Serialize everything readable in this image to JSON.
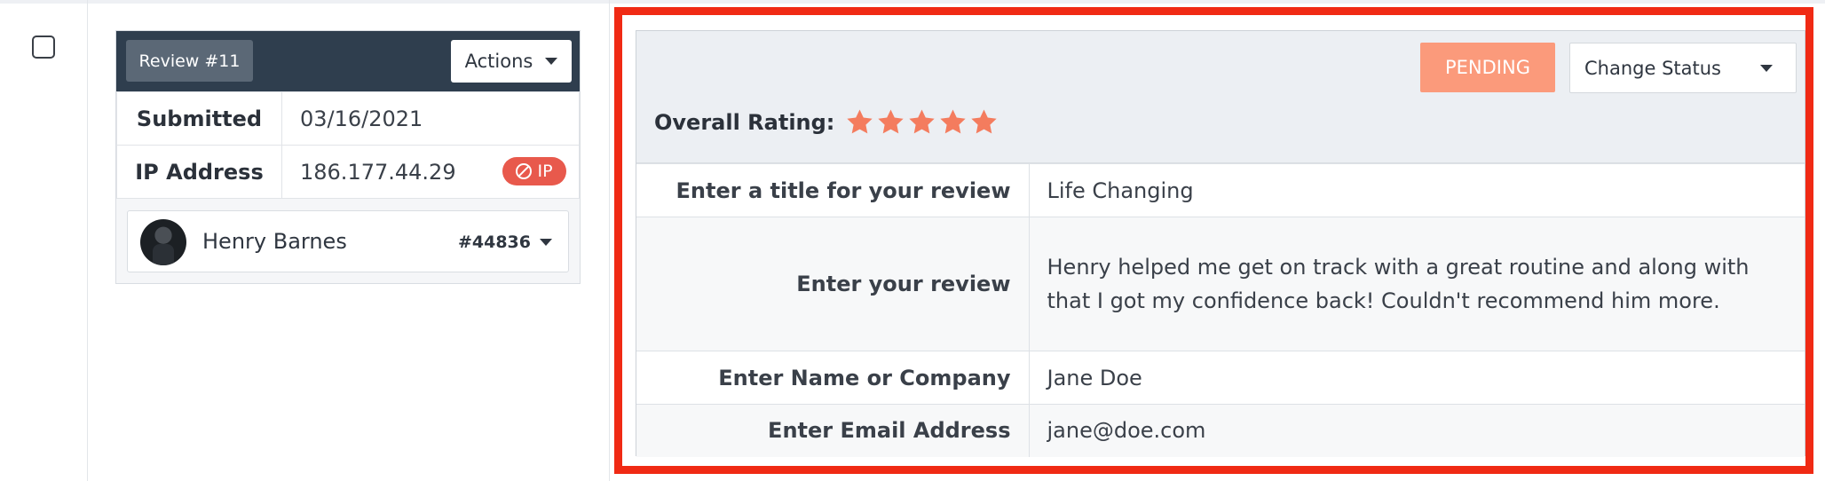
{
  "left_card": {
    "review_badge": "Review #11",
    "actions_label": "Actions",
    "submitted_label": "Submitted",
    "submitted_value": "03/16/2021",
    "ip_label": "IP Address",
    "ip_value": "186.177.44.29",
    "ip_ban_label": "IP",
    "user": {
      "name": "Henry Barnes",
      "id": "#44836"
    }
  },
  "review_panel": {
    "status_badge": "PENDING",
    "change_status_label": "Change Status",
    "overall_rating_label": "Overall Rating:",
    "rating": 5,
    "star_color": "#f47c5e",
    "fields": [
      {
        "label": "Enter a title for your review",
        "value": "Life Changing"
      },
      {
        "label": "Enter your review",
        "value_line1": "Henry helped me get on track with a great routine and along with",
        "value_line2": "that I got my confidence back! Couldn't recommend him more."
      },
      {
        "label": "Enter Name or Company",
        "value": "Jane Doe"
      },
      {
        "label": "Enter Email Address",
        "value": "jane@doe.com"
      }
    ]
  },
  "colors": {
    "highlight": "#f02a14",
    "header_dark": "#2f3e4e",
    "pending": "#fb9a7b",
    "ip_ban": "#e8594c"
  },
  "icons": [
    "checkbox-icon",
    "caret-down-icon",
    "ban-icon",
    "avatar",
    "star-icon"
  ]
}
